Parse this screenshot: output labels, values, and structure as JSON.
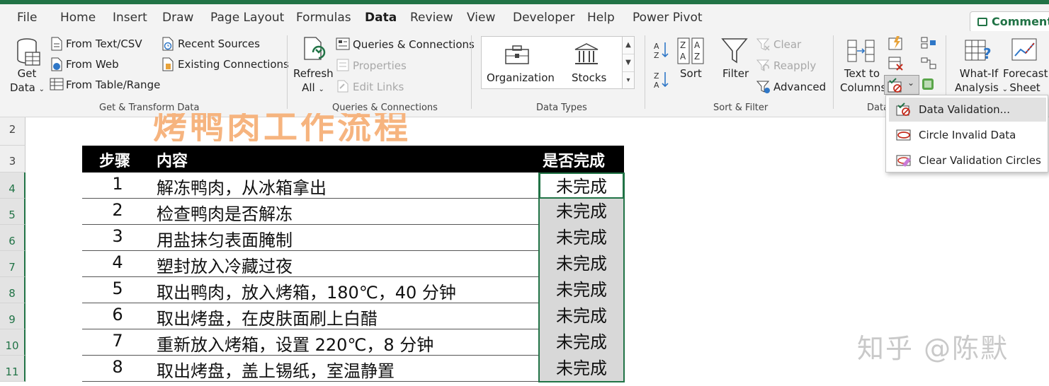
{
  "menu": {
    "tabs": [
      "File",
      "Home",
      "Insert",
      "Draw",
      "Page Layout",
      "Formulas",
      "Data",
      "Review",
      "View",
      "Developer",
      "Help",
      "Power Pivot"
    ],
    "active_tab": "Data",
    "comments_label": "Comments"
  },
  "ribbon": {
    "get_transform": {
      "get_data_line1": "Get",
      "get_data_line2": "Data",
      "from_text_csv": "From Text/CSV",
      "from_web": "From Web",
      "from_table_range": "From Table/Range",
      "recent_sources": "Recent Sources",
      "existing_connections": "Existing Connections",
      "group_label": "Get & Transform Data"
    },
    "queries": {
      "refresh_line1": "Refresh",
      "refresh_line2": "All",
      "queries_connections": "Queries & Connections",
      "properties": "Properties",
      "edit_links": "Edit Links",
      "group_label": "Queries & Connections"
    },
    "data_types": {
      "organization": "Organization",
      "stocks": "Stocks",
      "group_label": "Data Types"
    },
    "sort_filter": {
      "sort": "Sort",
      "filter": "Filter",
      "clear": "Clear",
      "reapply": "Reapply",
      "advanced": "Advanced",
      "group_label": "Sort & Filter"
    },
    "data_tools": {
      "text_to_line1": "Text to",
      "text_to_line2": "Columns",
      "group_label": "Data"
    },
    "forecast": {
      "what_if_line1": "What-If",
      "what_if_line2": "Analysis",
      "forecast_line1": "Forecast",
      "forecast_line2": "Sheet"
    }
  },
  "dropdown": {
    "items": [
      "Data Validation...",
      "Circle Invalid Data",
      "Clear Validation Circles"
    ]
  },
  "sheet": {
    "row_numbers": [
      "2",
      "3",
      "4",
      "5",
      "6",
      "7",
      "8",
      "9",
      "10",
      "11"
    ],
    "title": "烤鸭肉工作流程",
    "headers": {
      "step": "步骤",
      "content": "内容",
      "done": "是否完成"
    },
    "rows": [
      {
        "step": "1",
        "content": "解冻鸭肉，从冰箱拿出",
        "done": "未完成"
      },
      {
        "step": "2",
        "content": "检查鸭肉是否解冻",
        "done": "未完成"
      },
      {
        "step": "3",
        "content": "用盐抹匀表面腌制",
        "done": "未完成"
      },
      {
        "step": "4",
        "content": "塑封放入冷藏过夜",
        "done": "未完成"
      },
      {
        "step": "5",
        "content": "取出鸭肉，放入烤箱，180℃，40 分钟",
        "done": "未完成"
      },
      {
        "step": "6",
        "content": "取出烤盘，在皮肤面刷上白醋",
        "done": "未完成"
      },
      {
        "step": "7",
        "content": "重新放入烤箱，设置 220℃，8 分钟",
        "done": "未完成"
      },
      {
        "step": "8",
        "content": "取出烤盘，盖上锡纸，室温静置",
        "done": "未完成"
      }
    ],
    "watermark": "知乎 @陈默"
  },
  "colors": {
    "accent": "#217346",
    "title": "#f6b47f",
    "header_bg": "#000000",
    "done_bg": "#d8d8d8"
  }
}
